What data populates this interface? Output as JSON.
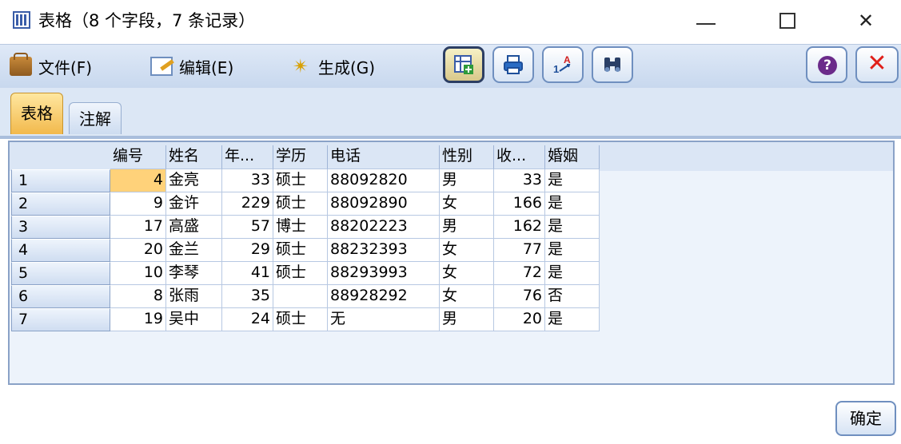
{
  "window": {
    "title": "表格（8 个字段，7 条记录）",
    "controls": {
      "minimize": "—",
      "maximize": "",
      "close": "✕"
    }
  },
  "menu": {
    "file": "文件(F)",
    "edit": "编辑(E)",
    "generate": "生成(G)"
  },
  "toolbar": {
    "icons": [
      "table-insert-icon",
      "print-icon",
      "sort-icon",
      "binoculars-icon"
    ],
    "help": "?",
    "close": "✕"
  },
  "tabs": {
    "table": "表格",
    "annotation": "注解"
  },
  "table": {
    "columns": [
      "编号",
      "姓名",
      "年...",
      "学历",
      "电话",
      "性别",
      "收...",
      "婚姻"
    ],
    "rows": [
      [
        "1",
        "4",
        "金亮",
        "33",
        "硕士",
        "88092820",
        "男",
        "33",
        "是"
      ],
      [
        "2",
        "9",
        "金许",
        "229",
        "硕士",
        "88092890",
        "女",
        "166",
        "是"
      ],
      [
        "3",
        "17",
        "高盛",
        "57",
        "博士",
        "88202223",
        "男",
        "162",
        "是"
      ],
      [
        "4",
        "20",
        "金兰",
        "29",
        "硕士",
        "88232393",
        "女",
        "77",
        "是"
      ],
      [
        "5",
        "10",
        "李琴",
        "41",
        "硕士",
        "88293993",
        "女",
        "72",
        "是"
      ],
      [
        "6",
        "8",
        "张雨",
        "35",
        "",
        "88928292",
        "女",
        "76",
        "否"
      ],
      [
        "7",
        "19",
        "吴中",
        "24",
        "硕士",
        "无",
        "男",
        "20",
        "是"
      ]
    ]
  },
  "footer": {
    "ok": "确定"
  }
}
